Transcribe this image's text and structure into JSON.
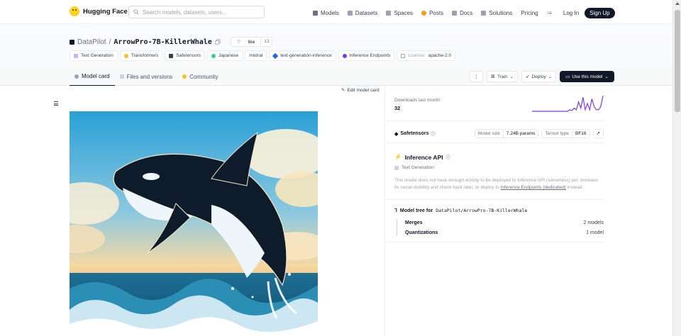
{
  "nav": {
    "brand": "Hugging Face",
    "search_placeholder": "Search models, datasets, users...",
    "links": [
      {
        "label": "Models",
        "icon": "models-icon",
        "color": "#6b7280"
      },
      {
        "label": "Datasets",
        "icon": "datasets-icon",
        "color": "#9ca3af"
      },
      {
        "label": "Spaces",
        "icon": "spaces-icon",
        "color": "#9ca3af"
      },
      {
        "label": "Posts",
        "icon": "posts-icon",
        "color": "#f59e0b"
      },
      {
        "label": "Docs",
        "icon": "docs-icon",
        "color": "#9ca3af"
      },
      {
        "label": "Solutions",
        "icon": "solutions-icon",
        "color": "#9ca3af"
      },
      {
        "label": "Pricing",
        "icon": "",
        "color": ""
      }
    ],
    "login": "Log In",
    "signup": "Sign Up"
  },
  "repo": {
    "org": "DataPilot",
    "separator": "/",
    "name": "ArrowPro-7B-KillerWhale",
    "like_label": "like",
    "like_count": "13"
  },
  "tags": [
    {
      "label": "Text Generation",
      "color": "#c4b5fd"
    },
    {
      "label": "Transformers",
      "color": "#fbbf24"
    },
    {
      "label": "Safetensors",
      "color": "#374151"
    },
    {
      "label": "Japanese",
      "color": "#34d399"
    },
    {
      "label": "mistral",
      "color": ""
    },
    {
      "label": "text-generation-inference",
      "color": "#2563eb"
    },
    {
      "label": "Inference Endpoints",
      "color": "#7c3aed"
    }
  ],
  "license": {
    "label": "License:",
    "value": "apache-2.0"
  },
  "tabs": [
    {
      "label": "Model card",
      "active": true,
      "color": "#9ca3af"
    },
    {
      "label": "Files and versions",
      "active": false,
      "color": "#9ca3af"
    },
    {
      "label": "Community",
      "active": false,
      "color": "#fbbf24"
    }
  ],
  "actions": {
    "train": "Train",
    "deploy": "Deploy",
    "use": "Use this model"
  },
  "edit_model_card": "Edit model card",
  "downloads": {
    "label": "Downloads last month",
    "value": "32",
    "sparkline": [
      0,
      0,
      0,
      0,
      0,
      0,
      0,
      0,
      0,
      0,
      0,
      0,
      0,
      0,
      0,
      0,
      0,
      0.1,
      0.05,
      0.2,
      0.1,
      0.6,
      0.2,
      0.9,
      0.1,
      0.5,
      0.1,
      0.8,
      0.3,
      0.1,
      0.1,
      0.3,
      1.0
    ],
    "color": "#7c3aed"
  },
  "safetensors": {
    "title": "Safetensors",
    "info": "ⓘ",
    "model_size_label": "Model size",
    "model_size_value": "7.24B params",
    "tensor_type_label": "Tensor type",
    "tensor_type_value": "BF16",
    "arrow": "↗"
  },
  "inference": {
    "title": "Inference API",
    "info": "ⓘ",
    "task": "Text Generation",
    "note_pre": "This model does not have enough activity to be deployed to Inference API (serverless) yet. Increase its social visibility and check back later, or deploy to ",
    "note_link": "Inference Endpoints (dedicated)",
    "note_post": " instead."
  },
  "model_tree": {
    "title": "Model tree for",
    "repo": "DataPilot/ArrowPro-7B-KillerWhale",
    "rows": [
      {
        "label": "Merges",
        "count": "2 models"
      },
      {
        "label": "Quantizations",
        "count": "1 model"
      }
    ]
  }
}
